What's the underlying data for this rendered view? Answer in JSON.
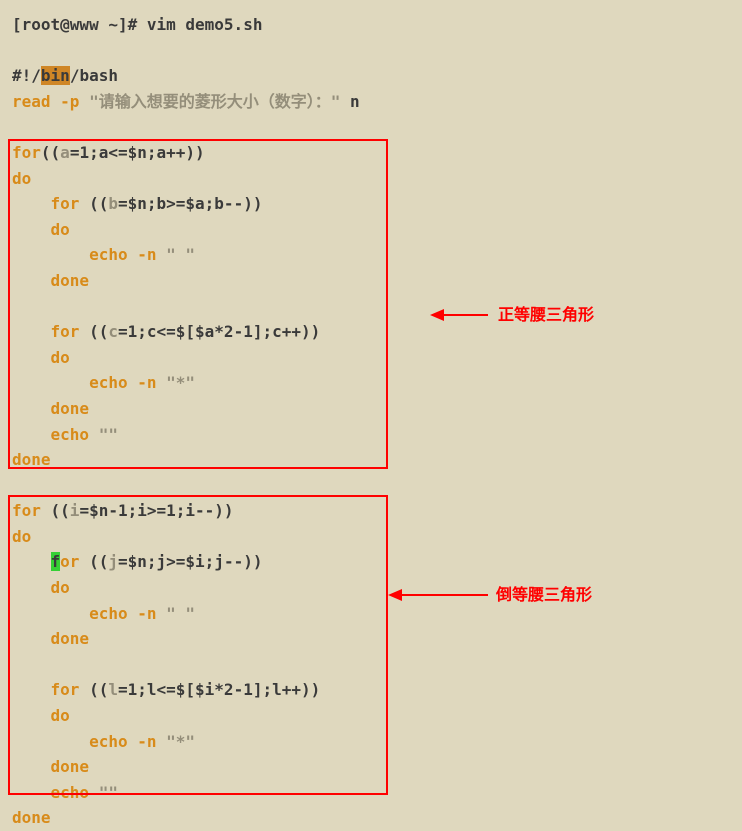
{
  "prompt": "[root@www ~]# vim demo5.sh",
  "shebang": {
    "p1": "#!/",
    "p2": "bin",
    "p3": "/bash"
  },
  "read_line": {
    "p1": "read -p ",
    "p2": "\"请输入想要的菱形大小（数字）：\"",
    "p3": " n"
  },
  "top": {
    "l1": {
      "p1": "for",
      "p2": "((",
      "p3": "a",
      "p4": "=1;a<=$n;a++",
      "p5": "))"
    },
    "l2": "do",
    "l3": {
      "p1": "    for ",
      "p2": "((",
      "p3": "b",
      "p4": "=$n;b>=$a;b--",
      "p5": "))"
    },
    "l4": "    do",
    "l5": {
      "p1": "        echo -n ",
      "p2": "\" \""
    },
    "l6": "    done",
    "l7": {
      "p1": "    for ",
      "p2": "((",
      "p3": "c",
      "p4": "=1;c<=$[$a*2-1];c++",
      "p5": "))"
    },
    "l8": "    do",
    "l9": {
      "p1": "        echo -n ",
      "p2": "\"*\""
    },
    "l10": "    done",
    "l11": {
      "p1": "    echo ",
      "p2": "\"\""
    },
    "l12": "done"
  },
  "bottom": {
    "l1": {
      "p1": "for ",
      "p2": "((",
      "p3": "i",
      "p4": "=$n-1;i>=1;i--",
      "p5": "))"
    },
    "l2": "do",
    "l3": {
      "p1a": "    ",
      "p1b": "f",
      "p1c": "or ",
      "p2": "((",
      "p3": "j",
      "p4": "=$n;j>=$i;j--",
      "p5": "))"
    },
    "l4": "    do",
    "l5": {
      "p1": "        echo -n ",
      "p2": "\" \""
    },
    "l6": "    done",
    "l7": {
      "p1": "    for ",
      "p2": "((",
      "p3": "l",
      "p4": "=1;l<=$[$i*2-1];l++",
      "p5": "))"
    },
    "l8": "    do",
    "l9": {
      "p1": "        echo -n ",
      "p2": "\"*\""
    },
    "l10": "    done",
    "l11": {
      "p1": "    echo ",
      "p2": "\"\""
    },
    "l12": "done"
  },
  "labels": {
    "upper": "正等腰三角形",
    "lower": "倒等腰三角形"
  }
}
